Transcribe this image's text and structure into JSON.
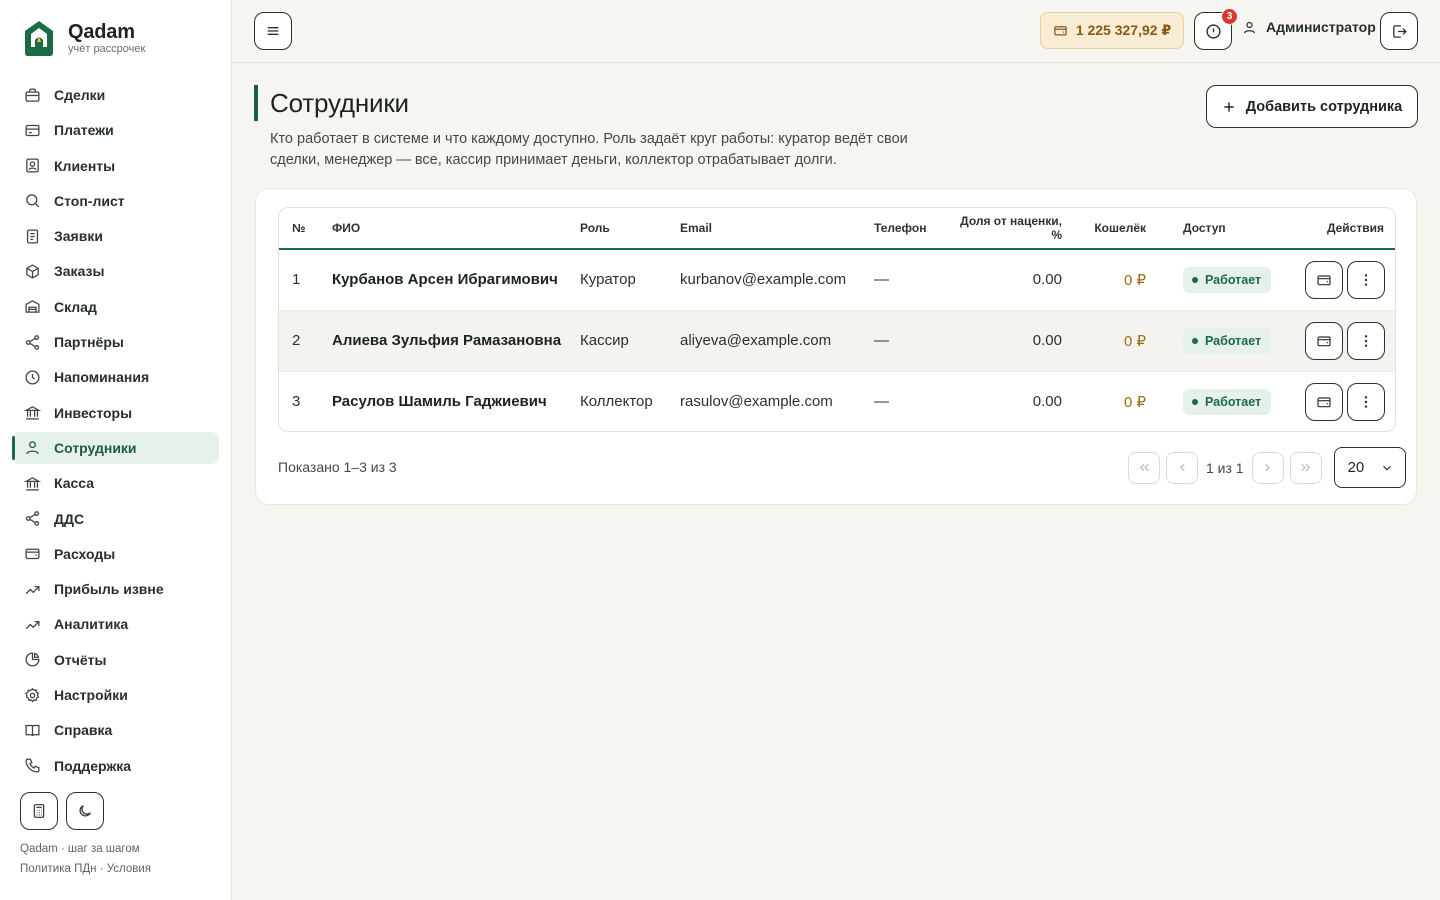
{
  "brand": {
    "name": "Qadam",
    "tagline": "учёт рассрочек"
  },
  "sidebar": {
    "items": [
      {
        "label": "Сделки",
        "icon": "briefcase-icon"
      },
      {
        "label": "Платежи",
        "icon": "credit-card-icon"
      },
      {
        "label": "Клиенты",
        "icon": "contact-icon"
      },
      {
        "label": "Стоп-лист",
        "icon": "search-icon"
      },
      {
        "label": "Заявки",
        "icon": "document-icon"
      },
      {
        "label": "Заказы",
        "icon": "box-icon"
      },
      {
        "label": "Склад",
        "icon": "warehouse-icon"
      },
      {
        "label": "Партнёры",
        "icon": "share-icon"
      },
      {
        "label": "Напоминания",
        "icon": "clock-icon"
      },
      {
        "label": "Инвесторы",
        "icon": "bank-icon"
      },
      {
        "label": "Сотрудники",
        "icon": "user-icon",
        "active": true
      },
      {
        "label": "Касса",
        "icon": "bank-icon"
      },
      {
        "label": "ДДС",
        "icon": "share-icon"
      },
      {
        "label": "Расходы",
        "icon": "wallet-icon"
      },
      {
        "label": "Прибыль извне",
        "icon": "trend-up-icon"
      },
      {
        "label": "Аналитика",
        "icon": "trend-up-icon"
      },
      {
        "label": "Отчёты",
        "icon": "pie-chart-icon"
      },
      {
        "label": "Настройки",
        "icon": "gear-icon"
      },
      {
        "label": "Справка",
        "icon": "book-icon"
      },
      {
        "label": "Поддержка",
        "icon": "phone-icon"
      }
    ],
    "footer_line1": "Qadam · шаг за шагом",
    "footer_line2": "Политика ПДн · Условия"
  },
  "topbar": {
    "balance": "1 225 327,92 ₽",
    "notifications_count": "3",
    "user": "Администратор"
  },
  "page": {
    "title": "Сотрудники",
    "description": "Кто работает в системе и что каждому доступно. Роль задаёт круг работы: куратор ведёт свои сделки, менеджер — все, кассир принимает деньги, коллектор отрабатывает долги.",
    "add_button": "Добавить сотрудника"
  },
  "table": {
    "columns": [
      "№",
      "ФИО",
      "Роль",
      "Email",
      "Телефон",
      "Доля от наценки, %",
      "Кошелёк",
      "Доступ",
      "Действия"
    ],
    "rows": [
      {
        "num": "1",
        "name": "Курбанов Арсен Ибрагимович",
        "role": "Куратор",
        "email": "kurbanov@example.com",
        "phone": "—",
        "share": "0.00",
        "wallet": "0 ₽",
        "status": "Работает"
      },
      {
        "num": "2",
        "name": "Алиева Зульфия Рамазановна",
        "role": "Кассир",
        "email": "aliyeva@example.com",
        "phone": "—",
        "share": "0.00",
        "wallet": "0 ₽",
        "status": "Работает"
      },
      {
        "num": "3",
        "name": "Расулов Шамиль Гаджиевич",
        "role": "Коллектор",
        "email": "rasulov@example.com",
        "phone": "—",
        "share": "0.00",
        "wallet": "0 ₽",
        "status": "Работает"
      }
    ]
  },
  "pagination": {
    "shown": "Показано 1–3 из 3",
    "page_label": "1 из 1",
    "page_size": "20"
  },
  "colors": {
    "accent": "#1b6b45",
    "accent_bg": "#e5f1e9",
    "balance_bg": "#f8ecd5",
    "balance_text": "#8a5a12",
    "badge": "#d93a2f"
  }
}
